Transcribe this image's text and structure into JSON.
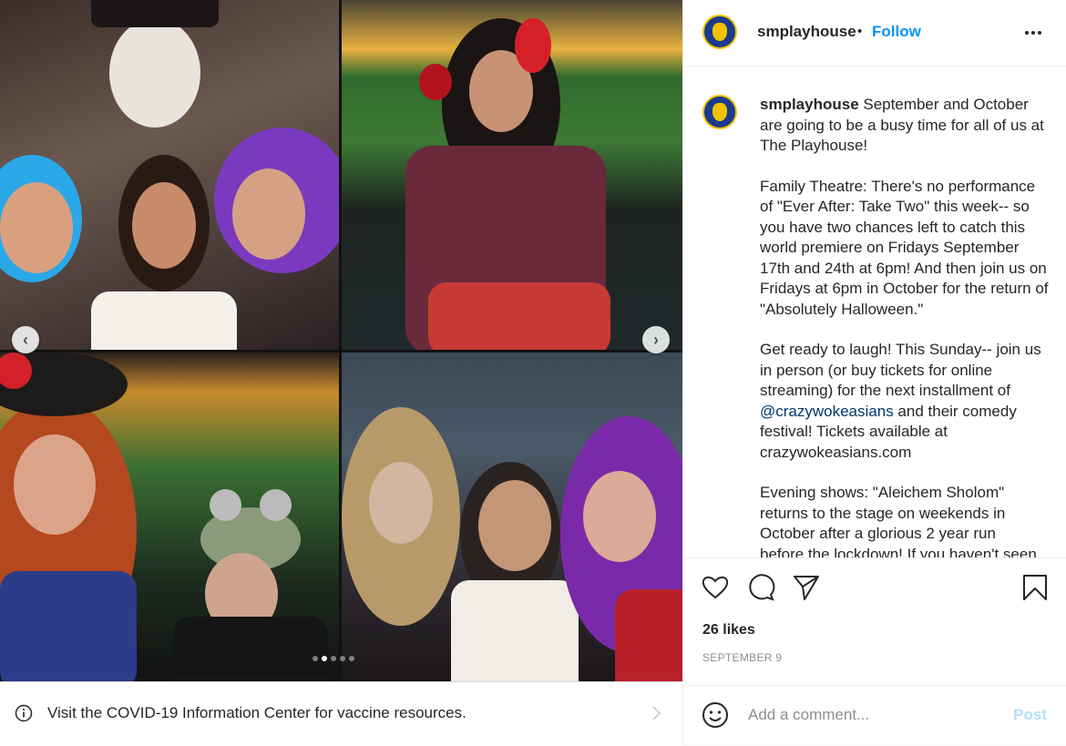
{
  "post": {
    "username": "smplayhouse",
    "separator": "•",
    "follow_label": "Follow",
    "more_icon": "more-horizontal-icon"
  },
  "caption": {
    "username": "smplayhouse",
    "p1": "September and October are going to be a busy time for all of us at The Playhouse!",
    "p2": "Family Theatre: There's no performance of \"Ever After: Take Two\" this week-- so you have two chances left to catch this world premiere on Fridays September 17th and 24th at 6pm! And then join us on Fridays at 6pm in October for the return of \"Absolutely Halloween.\"",
    "p3_a": "Get ready to laugh! This Sunday-- join us in person (or buy tickets for online streaming) for the next installment of ",
    "p3_link": "@crazywokeasians",
    "p3_b": " and their comedy festival! Tickets available at crazywokeasians.com",
    "p4": "Evening shows: \"Aleichem Sholom\" returns to the stage on weekends in October after a glorious 2 year run",
    "p4_cut": "before the lockdown! If you haven't seen"
  },
  "actions": {
    "like_icon": "heart-icon",
    "comment_icon": "comment-icon",
    "share_icon": "paper-plane-icon",
    "save_icon": "bookmark-icon",
    "likes": "26 likes",
    "date": "SEPTEMBER 9"
  },
  "comment": {
    "emoji_icon": "smiley-icon",
    "placeholder": "Add a comment...",
    "post_label": "Post"
  },
  "covid_banner": {
    "info_icon": "info-icon",
    "text": "Visit the COVID-19 Information Center for vaccine resources.",
    "chevron_icon": "chevron-right-icon"
  },
  "carousel": {
    "total_slides": 5,
    "active_slide": 2
  }
}
